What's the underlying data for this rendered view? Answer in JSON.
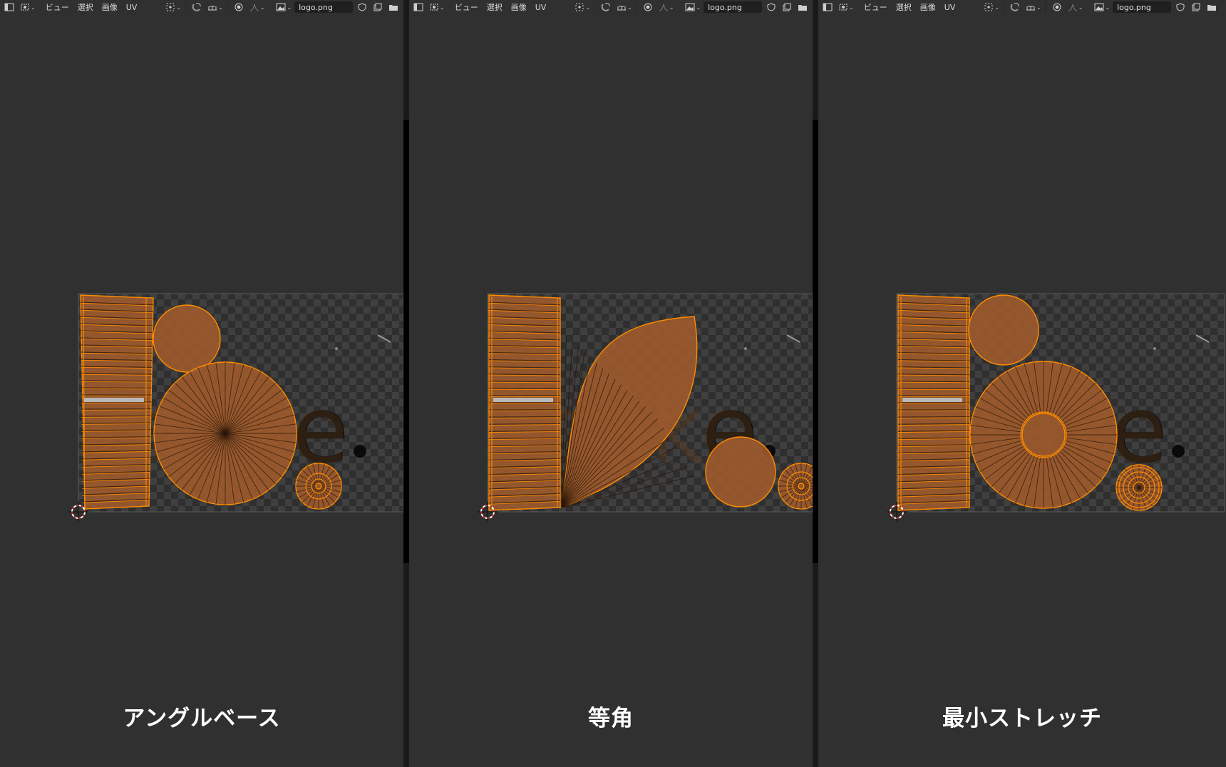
{
  "header": {
    "menus": [
      "ビュー",
      "選択",
      "画像",
      "UV"
    ],
    "image_name": "logo.png"
  },
  "panels": [
    {
      "caption": "アングルベース",
      "method": "angle-based"
    },
    {
      "caption": "等角",
      "method": "conformal"
    },
    {
      "caption": "最小ストレッチ",
      "method": "minimum-stretch"
    }
  ],
  "colors": {
    "background": "#303030",
    "uv_fill": "#9c5a2c",
    "uv_edge": "#ff8c00",
    "checker_dark": "#2f2f2f",
    "checker_light": "#3f3f3f",
    "logo_text": "#0a0a0a"
  },
  "icons": {
    "editor_type": "image-editor-icon",
    "mode": "uv-select-mode-icon",
    "pivot": "pivot-point-icon",
    "snap": "snap-magnet-icon",
    "snap_target": "snap-target-icon",
    "proportional": "proportional-edit-icon",
    "falloff": "falloff-curve-icon",
    "browse_image": "browse-image-icon",
    "fake_user": "fake-user-shield-icon",
    "new_image": "new-image-icon",
    "open_image": "open-folder-icon"
  }
}
